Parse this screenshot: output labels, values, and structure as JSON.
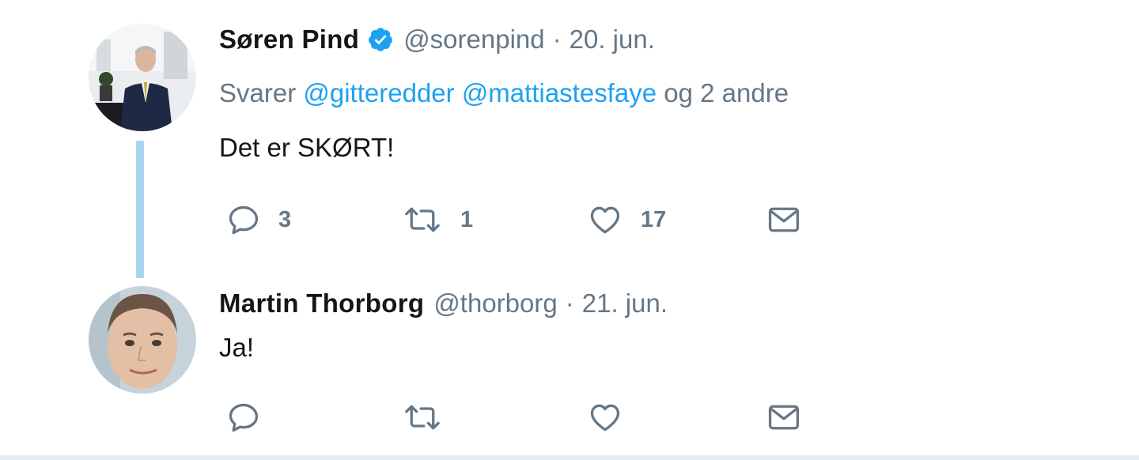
{
  "colors": {
    "link": "#1da1f2",
    "muted": "#657786",
    "thread_line": "#a9d4f0",
    "verified": "#1da1f2"
  },
  "tweets": [
    {
      "name": "Søren Pind",
      "verified": true,
      "handle": "@sorenpind",
      "separator": "·",
      "date": "20. jun.",
      "reply_prefix": "Svarer",
      "reply_mentions": [
        "@gitteredder",
        "@mattiastesfaye"
      ],
      "reply_suffix": "og 2 andre",
      "text": "Det er SKØRT!",
      "actions": {
        "reply": {
          "icon": "reply-icon",
          "count": "3"
        },
        "retweet": {
          "icon": "retweet-icon",
          "count": "1"
        },
        "like": {
          "icon": "heart-icon",
          "count": "17"
        },
        "dm": {
          "icon": "envelope-icon"
        }
      }
    },
    {
      "name": "Martin Thorborg",
      "handle": "@thorborg",
      "separator": "·",
      "date": "21. jun.",
      "text": "Ja!",
      "actions": {
        "reply": {
          "icon": "reply-icon",
          "count": ""
        },
        "retweet": {
          "icon": "retweet-icon",
          "count": ""
        },
        "like": {
          "icon": "heart-icon",
          "count": ""
        },
        "dm": {
          "icon": "envelope-icon"
        }
      }
    }
  ]
}
